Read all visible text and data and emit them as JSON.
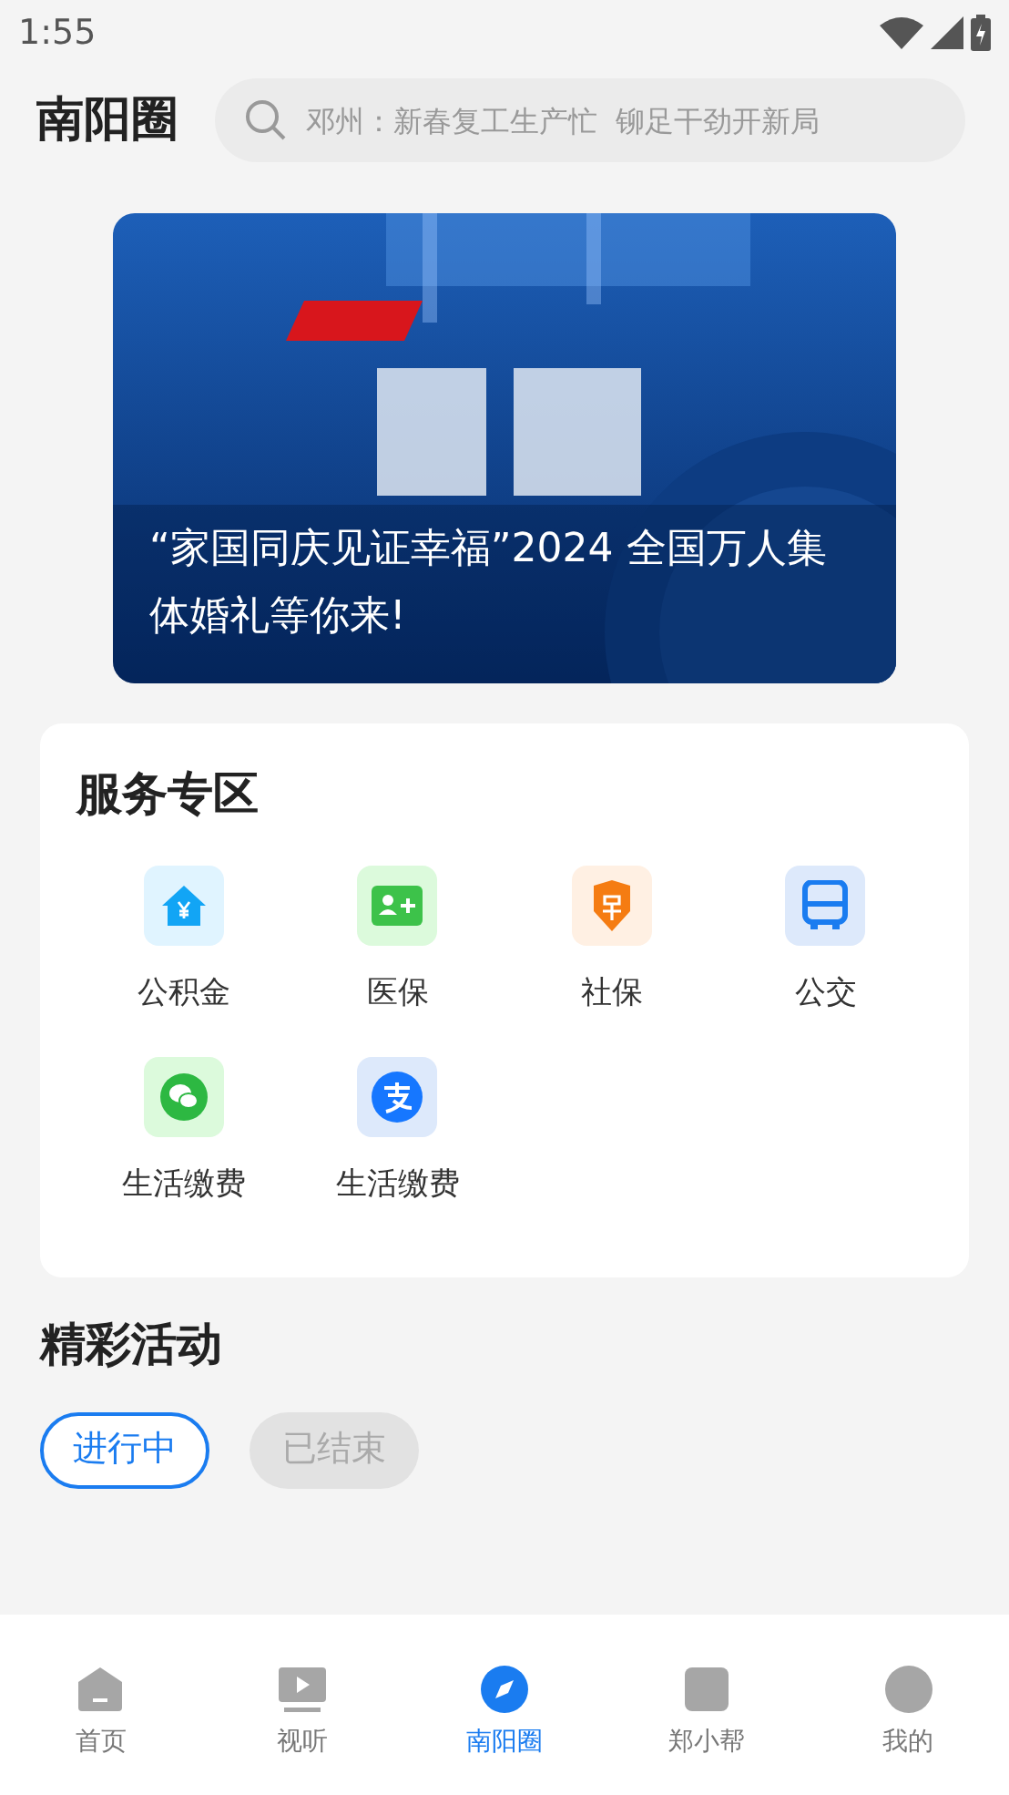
{
  "status_bar": {
    "time": "1:55"
  },
  "header": {
    "title": "南阳圈",
    "search": {
      "placeholder": "邓州：新春复工生产忙  铆足干劲开新局"
    }
  },
  "banner": {
    "caption": "“家国同庆见证幸福”2024 全国万人集体婚礼等你来!"
  },
  "services": {
    "title": "服务专区",
    "items": [
      {
        "label": "公积金",
        "kind": "fund"
      },
      {
        "label": "医保",
        "kind": "medical"
      },
      {
        "label": "社保",
        "kind": "social"
      },
      {
        "label": "公交",
        "kind": "bus"
      },
      {
        "label": "生活缴费",
        "kind": "chat"
      },
      {
        "label": "生活缴费",
        "kind": "pay"
      }
    ]
  },
  "activities": {
    "title": "精彩活动",
    "tabs": [
      {
        "label": "进行中",
        "selected": true
      },
      {
        "label": "已结束",
        "selected": false
      }
    ]
  },
  "bottom_nav": [
    {
      "label": "首页",
      "kind": "home",
      "selected": false
    },
    {
      "label": "视听",
      "kind": "video",
      "selected": false
    },
    {
      "label": "南阳圈",
      "kind": "compass",
      "selected": true
    },
    {
      "label": "郑小帮",
      "kind": "square",
      "selected": false
    },
    {
      "label": "我的",
      "kind": "person",
      "selected": false
    }
  ]
}
